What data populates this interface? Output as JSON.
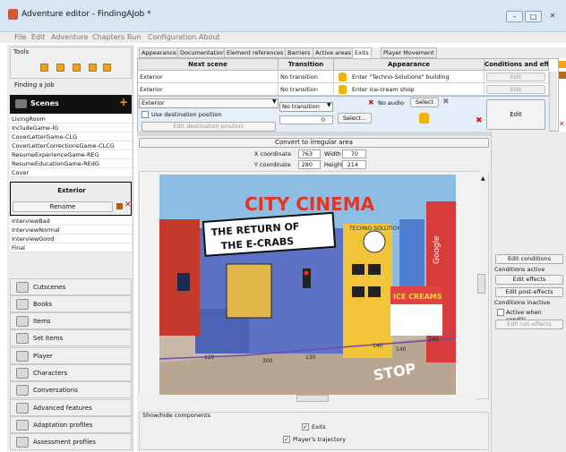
{
  "window": {
    "title": "Adventure editor - FindingAJob *"
  },
  "menu": [
    "File",
    "Edit",
    "Adventure",
    "Chapters",
    "Run",
    "Configuration",
    "About"
  ],
  "left": {
    "tools_label": "Tools",
    "chapter_title": "Finding a Job",
    "scenes_title": "Scenes",
    "scenes": [
      "LivingRoom",
      "IncludeGame-IG",
      "CoverLetterGame-CLG",
      "CoverLetterCorrectionsGame-CLCG",
      "ResumeExperienceGame-REG",
      "ResumeEducationGame-REdG",
      "Cover"
    ],
    "selected_scene": "Exterior",
    "rename_label": "Rename",
    "scenes_after": [
      "InterviewBad",
      "InterviewNormal",
      "InterviewGood",
      "Final"
    ],
    "nav": [
      "Cutscenes",
      "Books",
      "Items",
      "Set items",
      "Player",
      "Characters",
      "Conversations",
      "Advanced features",
      "Adaptation profiles",
      "Assessment profiles"
    ]
  },
  "tabs": [
    "Appearance",
    "Documentation",
    "Element references",
    "Barriers",
    "Active areas",
    "Exits",
    "Player Movement"
  ],
  "exits_table": {
    "headers": [
      "Next scene",
      "Transition",
      "Appearance",
      "Conditions and effe."
    ],
    "rows": [
      {
        "scene": "Exterior",
        "transition": "No transition",
        "appearance": "Enter \"Techno-Solutions\" building",
        "edit": "Edit"
      },
      {
        "scene": "Exterior",
        "transition": "No transition",
        "appearance": "Enter ice-cream shop",
        "edit": "Edit"
      }
    ],
    "detail": {
      "scene_select": "Exterior",
      "use_dest_label": "Use destination position",
      "edit_dest_label": "Edit destination position",
      "transition_select": "No transition",
      "transition_time": "0",
      "no_audio_label": "No audio",
      "select_label": "Select",
      "select2_label": "Select...",
      "edit_label": "Edit"
    }
  },
  "editor": {
    "convert_label": "Convert to irregular area",
    "x_label": "X coordinate",
    "x_value": "763",
    "width_label": "Width",
    "width_value": "70",
    "y_label": "Y coordinate",
    "y_value": "280",
    "height_label": "Height",
    "height_value": "214",
    "show_hide_label": "Show/hide components",
    "exits_check": "Exits",
    "trajectory_check": "Player's trajectory"
  },
  "scene_art": {
    "cinema_sign": "CITY CINEMA",
    "movie_title_1": "THE RETURN OF",
    "movie_title_2": "THE E-CRABS",
    "ice_creams": "ICE CREAMS",
    "google_sign": "Google",
    "techno_sign": "TECHNO SOLUTIONS",
    "road_text": "STOP",
    "measure_labels": [
      "120",
      "300",
      "130",
      "140",
      "140",
      "240"
    ]
  },
  "right": {
    "edit_conditions": "Edit conditions",
    "conditions_active": "Conditions active",
    "edit_effects": "Edit effects",
    "edit_post_effects": "Edit post-effects",
    "conditions_inactive": "Conditions inactive",
    "active_when": "Active when conditi...",
    "edit_not_effects": "Edit not-effects"
  }
}
